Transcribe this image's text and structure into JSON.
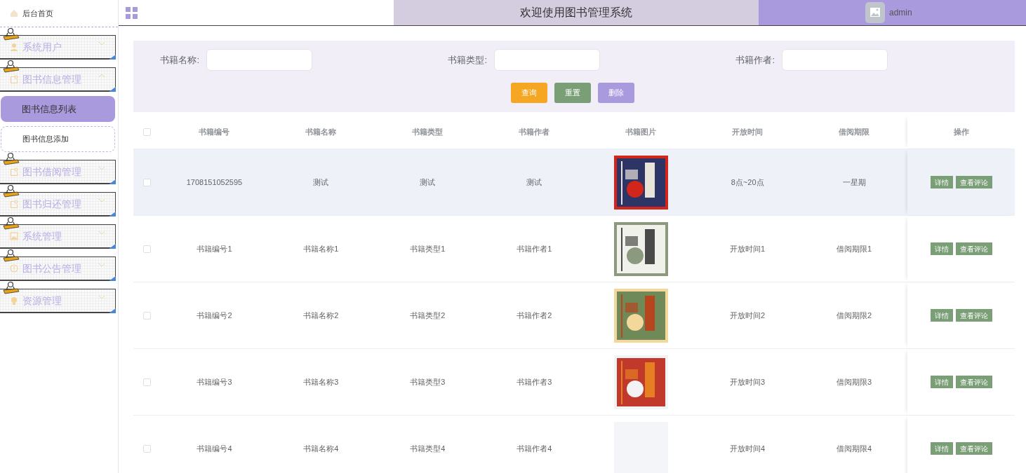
{
  "sidebar": {
    "home": "后台首页",
    "menus": [
      {
        "label": "系统用户",
        "expanded": false
      },
      {
        "label": "图书信息管理",
        "expanded": true,
        "children": [
          {
            "label": "图书信息列表",
            "selected": true
          },
          {
            "label": "图书信息添加",
            "selected": false
          }
        ]
      },
      {
        "label": "图书借阅管理",
        "expanded": false
      },
      {
        "label": "图书归还管理",
        "expanded": false
      },
      {
        "label": "系统管理",
        "expanded": false
      },
      {
        "label": "图书公告管理",
        "expanded": false
      },
      {
        "label": "资源管理",
        "expanded": false
      }
    ]
  },
  "header": {
    "title": "欢迎使用图书管理系统",
    "user": "admin"
  },
  "search": {
    "fields": [
      {
        "label": "书籍名称:"
      },
      {
        "label": "书籍类型:"
      },
      {
        "label": "书籍作者:"
      }
    ],
    "buttons": [
      {
        "label": "查询",
        "kind": "query"
      },
      {
        "label": "重置",
        "kind": "reset"
      },
      {
        "label": "删除",
        "kind": "delete"
      }
    ]
  },
  "table": {
    "all_checked": false,
    "columns": [
      "书籍编号",
      "书籍名称",
      "书籍类型",
      "书籍作者",
      "书籍图片",
      "开放时间",
      "借阅期限",
      "操作"
    ],
    "rows": [
      {
        "checked": false,
        "highlighted": true,
        "cover": true,
        "cells": [
          "1708151052595",
          "测试",
          "测试",
          "测试",
          "",
          "8点~20点",
          "一星期"
        ],
        "actions": [
          "详情",
          "查看评论"
        ]
      },
      {
        "checked": false,
        "highlighted": false,
        "cover": true,
        "cells": [
          "书籍编号1",
          "书籍名称1",
          "书籍类型1",
          "书籍作者1",
          "",
          "开放时间1",
          "借阅期限1"
        ],
        "actions": [
          "详情",
          "查看评论"
        ]
      },
      {
        "checked": false,
        "highlighted": false,
        "cover": true,
        "cells": [
          "书籍编号2",
          "书籍名称2",
          "书籍类型2",
          "书籍作者2",
          "",
          "开放时间2",
          "借阅期限2"
        ],
        "actions": [
          "详情",
          "查看评论"
        ]
      },
      {
        "checked": false,
        "highlighted": false,
        "cover": true,
        "cells": [
          "书籍编号3",
          "书籍名称3",
          "书籍类型3",
          "书籍作者3",
          "",
          "开放时间3",
          "借阅期限3"
        ],
        "actions": [
          "详情",
          "查看评论"
        ]
      },
      {
        "checked": false,
        "highlighted": false,
        "cover": false,
        "cells": [
          "书籍编号4",
          "书籍名称4",
          "书籍类型4",
          "书籍作者4",
          "",
          "开放时间4",
          "借阅期限4"
        ],
        "actions": [
          "详情",
          "查看评论"
        ]
      }
    ]
  }
}
